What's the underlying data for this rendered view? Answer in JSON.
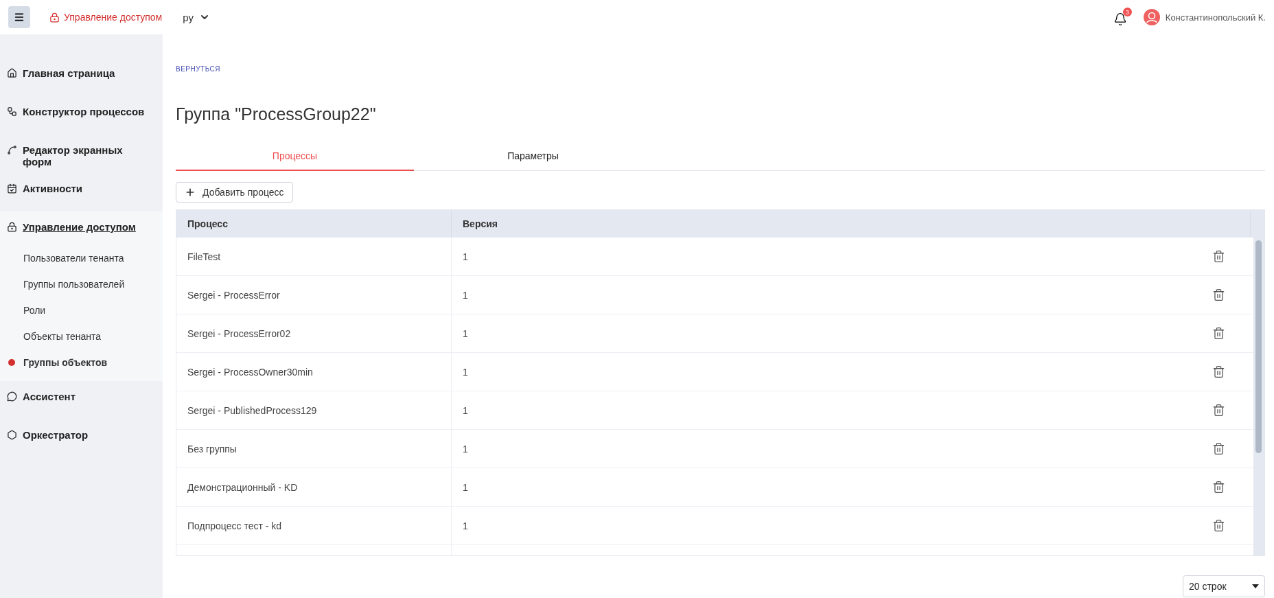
{
  "header": {
    "app_title": "Управление доступом",
    "language": "ру",
    "notifications_count": "3",
    "user_name": "Константинопольский К."
  },
  "sidebar": {
    "items": [
      {
        "label": "Главная страница",
        "selected": false
      },
      {
        "label": "Конструктор процессов",
        "selected": false
      },
      {
        "label": "Редактор экранных форм",
        "selected": false
      },
      {
        "label": "Активности",
        "selected": false
      },
      {
        "label": "Управление доступом",
        "selected": true,
        "children": [
          {
            "label": "Пользователи тенанта",
            "selected": false
          },
          {
            "label": "Группы пользователей",
            "selected": false
          },
          {
            "label": "Роли",
            "selected": false
          },
          {
            "label": "Объекты тенанта",
            "selected": false
          },
          {
            "label": "Группы объектов",
            "selected": true
          }
        ]
      },
      {
        "label": "Ассистент",
        "selected": false
      },
      {
        "label": "Оркестратор",
        "selected": false
      }
    ]
  },
  "back_link": "ВЕРНУТЬСЯ",
  "page_title": "Группа \"ProcessGroup22\"",
  "tabs": [
    {
      "label": "Процессы",
      "selected": true
    },
    {
      "label": "Параметры",
      "selected": false
    }
  ],
  "add_button": "Добавить процесс",
  "table": {
    "columns": [
      "Процесс",
      "Версия"
    ],
    "rows": [
      {
        "process": "FileTest",
        "version": "1"
      },
      {
        "process": "Sergei - ProcessError",
        "version": "1"
      },
      {
        "process": "Sergei - ProcessError02",
        "version": "1"
      },
      {
        "process": "Sergei - ProcessOwner30min",
        "version": "1"
      },
      {
        "process": "Sergei - PublishedProcess129",
        "version": "1"
      },
      {
        "process": "Без группы",
        "version": "1"
      },
      {
        "process": "Демонстрационный - KD",
        "version": "1"
      },
      {
        "process": "Подпроцесс тест - kd",
        "version": "1"
      }
    ]
  },
  "page_size": "20 строк"
}
